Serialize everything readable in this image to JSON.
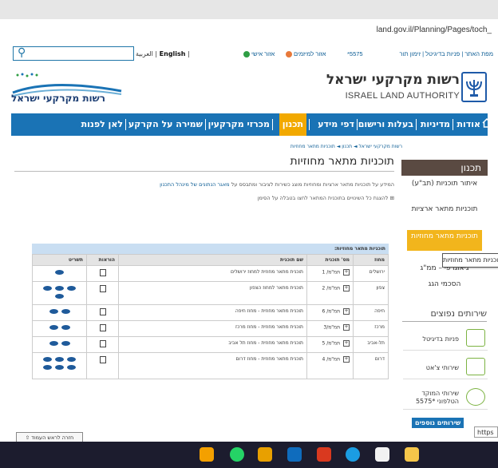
{
  "browser": {
    "url": "land.gov.il/Planning/Pages/toch_",
    "address_stub": "https"
  },
  "utility": {
    "lang_arabic": "العربية",
    "lang_english": "English",
    "login_personal": "אזור אישי",
    "login_org": "אזור למיזמים",
    "phone": "*5575",
    "top_links": "מפת האתר | פניות בדיגיטל | זימון תור"
  },
  "logo": {
    "left_name": "רשות מקרקעי ישראל",
    "right_name_he": "רשות מקרקעי ישראל",
    "right_name_en": "ISRAEL LAND AUTHORITY"
  },
  "nav": {
    "items": [
      "אודות",
      "מדיניות",
      "בעלות ורישום",
      "דפי מידע",
      "תכנון",
      "מכרזי מקרקעין",
      "שמירה על הקרקע",
      "לאן לפנות"
    ],
    "active": "תכנון"
  },
  "breadcrumb": "רשות מקרקעי ישראל ◄ תכנון ◄ תוכניות מתאר מחוזיות",
  "page": {
    "title": "תוכניות מתאר מחוזיות",
    "intro_prefix": "המידע על תוכניות מתאר ארציות ומחוזיות מוצג כשירות לציבור ומתבסס על",
    "intro_link": "מאגר הנתונים של מינהל התכנון",
    "hint": "להצגת כל השינויים בתוכנית המתאר לחצו בטבלה על הסימן ⊞"
  },
  "sidebar": {
    "header": "תכנון",
    "items": [
      "איתור תוכניות (תב\"ע)",
      "תוכניות מתאר ארציות",
      "תוכניות מתאר מחוזיות",
      "גיאוגרפי – ממ\"ג",
      "הסכמי הגג"
    ],
    "tooltip": "תוכניות מתאר מחוזיות",
    "services_header": "שירותים נפוצים",
    "services": [
      "פניות בדיגיטל",
      "שירותי צ'אט",
      "שירותי המוקד הטלפוני *5575"
    ],
    "more_services": "שירותים נוספים"
  },
  "table": {
    "caption": "תוכניות מתאר מחוזיות:",
    "headers": [
      "מחוז",
      "מס' תוכנית",
      "שם תוכנית",
      "הוראות",
      "תשריט"
    ],
    "rows": [
      {
        "district": "ירושלים",
        "plan_no": "תמ\"מ/ 1",
        "name": "תוכנית מתאר מחוזית למחוז ירושלים",
        "maps": 1
      },
      {
        "district": "צפון",
        "plan_no": "תמ\"מ/ 2",
        "name": "תוכנית מתאר למחוז הצפון",
        "maps": 4
      },
      {
        "district": "חיפה",
        "plan_no": "תמ\"מ/ 6",
        "name": "תוכנית מתאר מחוזית - מחוז חיפה",
        "maps": 2
      },
      {
        "district": "מרכז",
        "plan_no": "תמ\"מ/3",
        "name": "תוכנית מתאר מחוזית - מחוז מרכז",
        "maps": 2
      },
      {
        "district": "תל-אביב",
        "plan_no": "תמ\"מ/ 5",
        "name": "תוכנית מתאר מחוזית - מחוז תל אביב",
        "maps": 2
      },
      {
        "district": "דרום",
        "plan_no": "תמ\"מ/ 4",
        "name": "תוכנית מתאר מחוזית - מחוז דרום",
        "maps": 6
      }
    ]
  },
  "back_to_top": "חזרה לראש העמוד",
  "colors": {
    "nav": "#1a73b5",
    "active": "#f2a900",
    "sidebar_head": "#5a4a42"
  }
}
